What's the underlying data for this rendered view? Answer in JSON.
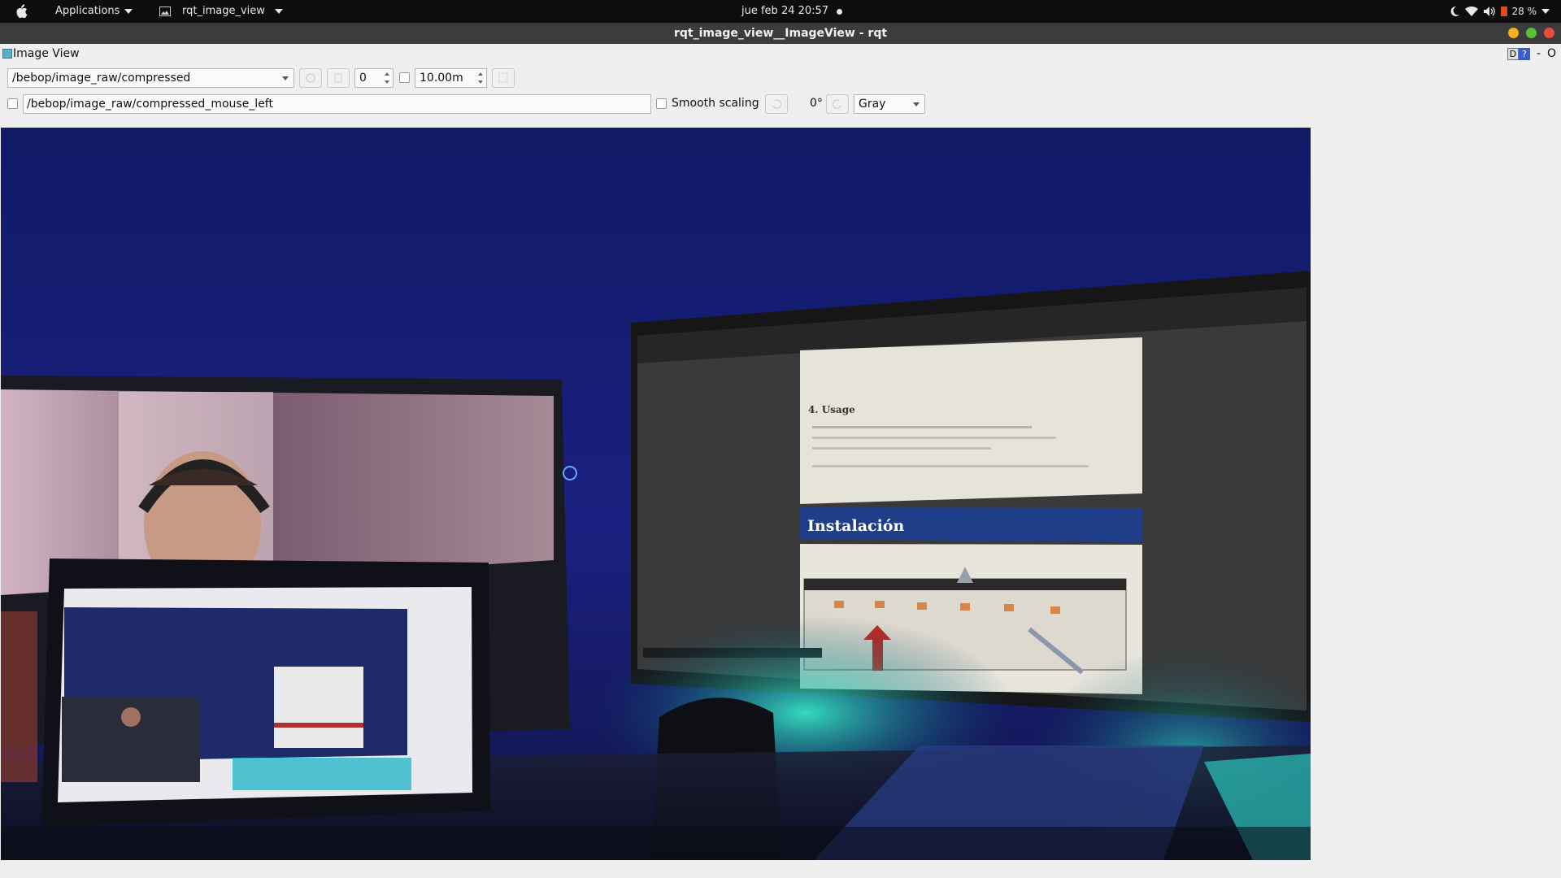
{
  "top_panel": {
    "activities_icon": "apple-icon",
    "applications_label": "Applications",
    "app_name": "rqt_image_view",
    "clock": "jue feb 24  20:57",
    "battery": "28 %"
  },
  "window": {
    "title": "rqt_image_view__ImageView - rqt"
  },
  "dock": {
    "title": "Image View",
    "d_label": "D",
    "help_label": "?",
    "minimize_label": "-",
    "close_label": "O"
  },
  "toolbar": {
    "topic": "/bebop/image_raw/compressed",
    "spin_value": "0",
    "time_value": "10.00m",
    "mouse_topic": "/bebop/image_raw/compressed_mouse_left",
    "smooth_scaling_label": "Smooth scaling",
    "rotation": "0°",
    "colormap": "Gray"
  },
  "image_content": {
    "slide_heading": "Instalación",
    "doc_heading": "4. Usage"
  }
}
